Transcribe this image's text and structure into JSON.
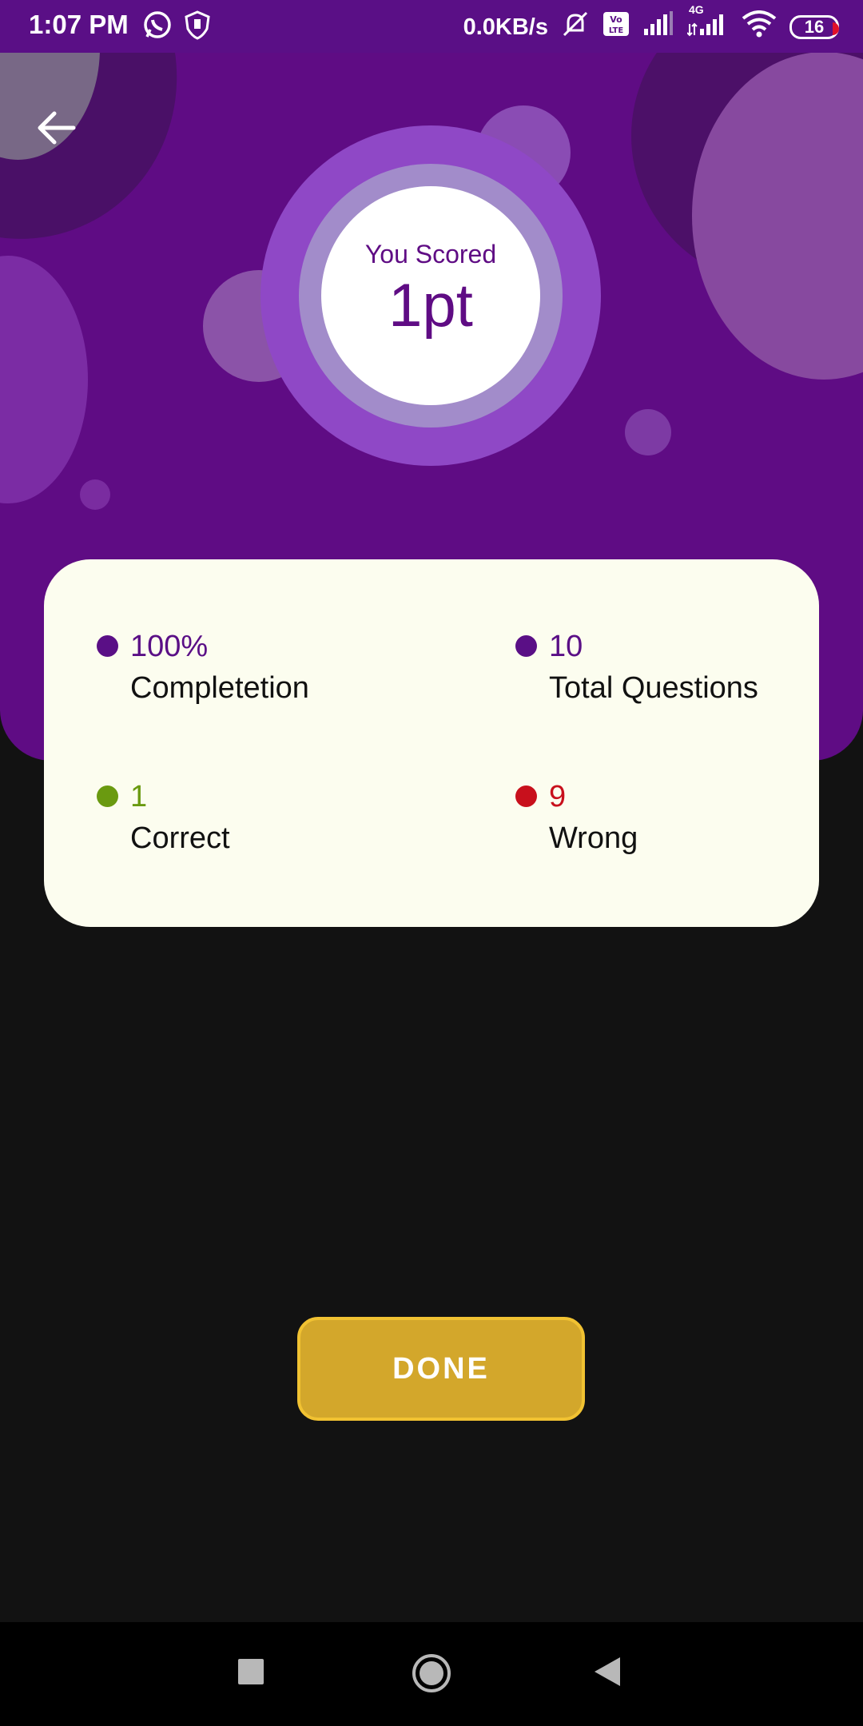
{
  "status_bar": {
    "time": "1:07 PM",
    "speed": "0.0KB/s",
    "network": "4G",
    "battery": "16",
    "icons": [
      "whatsapp-icon",
      "shield-icon",
      "mute-icon",
      "volte-icon",
      "signal-icon",
      "signal-4g-icon",
      "wifi-icon",
      "battery-icon"
    ]
  },
  "header": {
    "back_icon": "arrow-left-icon",
    "score_label": "You Scored",
    "score_value": "1pt",
    "background_color": "#5f0c84"
  },
  "stats": [
    {
      "value": "100%",
      "label": "Completetion",
      "color": "#5a0f86"
    },
    {
      "value": "10",
      "label": "Total Questions",
      "color": "#5a0f86"
    },
    {
      "value": "1",
      "label": "Correct",
      "color": "#6a9a10"
    },
    {
      "value": "9",
      "label": "Wrong",
      "color": "#c8101c"
    }
  ],
  "done_button": {
    "label": "DONE",
    "color": "#d3a72b"
  },
  "nav_bar": {
    "icons": [
      "square-icon",
      "home-circle-icon",
      "back-triangle-icon"
    ]
  }
}
